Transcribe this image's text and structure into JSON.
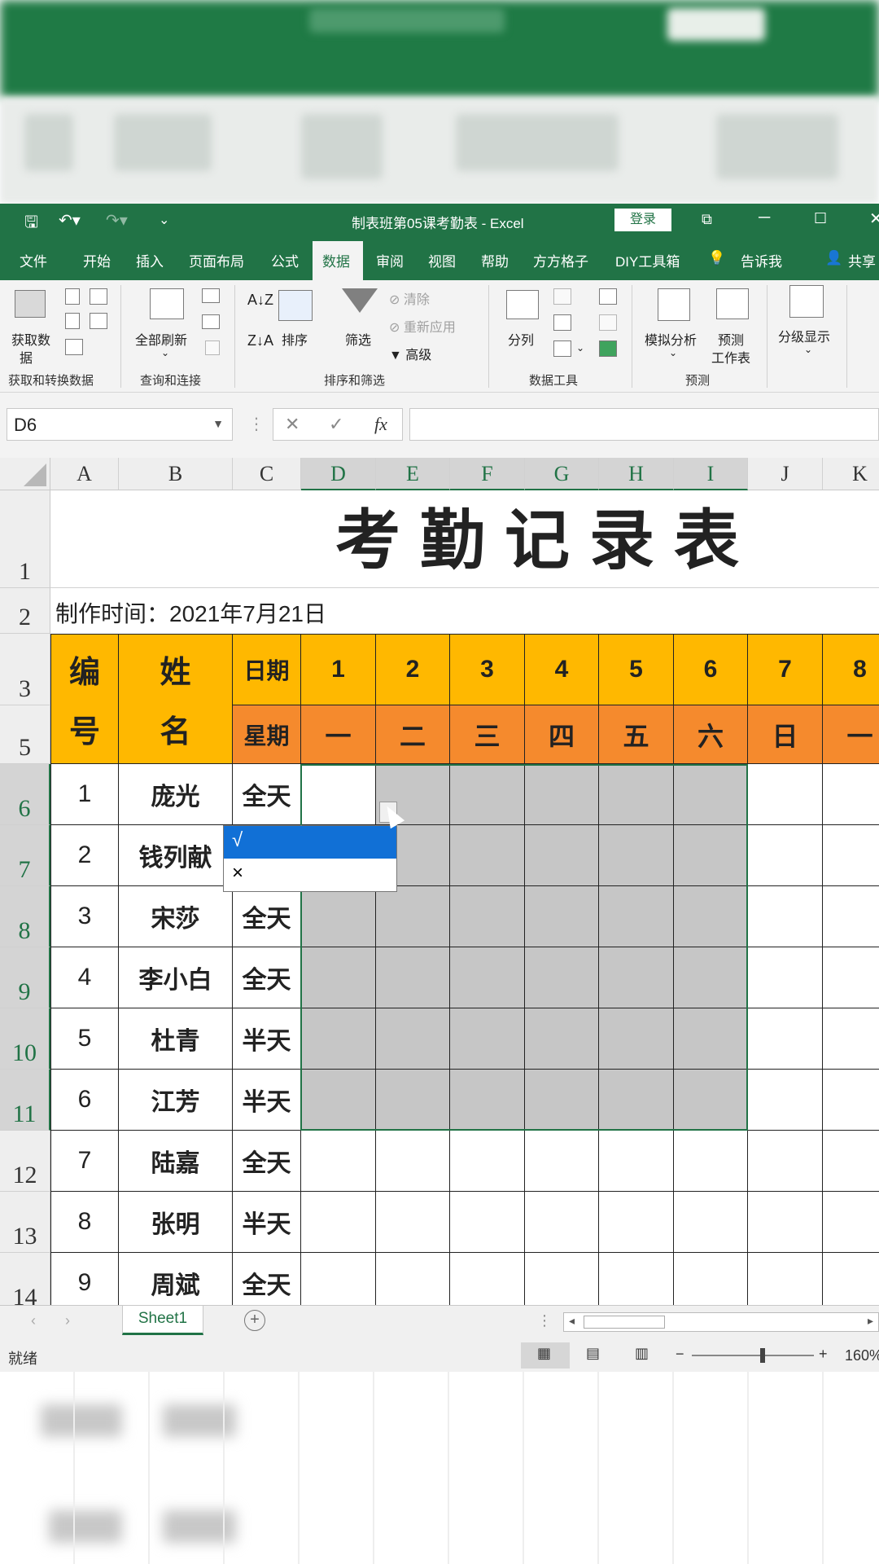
{
  "window": {
    "title": "制表班第05课考勤表  -  Excel",
    "login": "登录",
    "minimize": "─",
    "maximize": "☐",
    "close": "✕",
    "restore": "⧉"
  },
  "menu": [
    "文件",
    "开始",
    "插入",
    "页面布局",
    "公式",
    "数据",
    "审阅",
    "视图",
    "帮助",
    "方方格子",
    "DIY工具箱",
    "告诉我",
    "共享"
  ],
  "ribbon": {
    "get_data": "获取数",
    "get_data2": "据",
    "get_group": "获取和转换数据",
    "refresh": "全部刷新",
    "query_group": "查询和连接",
    "sort": "排序",
    "filter": "筛选",
    "clear": "清除",
    "reapply": "重新应用",
    "advanced": "高级",
    "sort_group": "排序和筛选",
    "split": "分列",
    "tools_group": "数据工具",
    "whatif": "模拟分析",
    "forecast1": "预测",
    "forecast2": "工作表",
    "forecast_group": "预测",
    "outline": "分级显示"
  },
  "formula_bar": {
    "name_box": "D6",
    "cancel": "✕",
    "enter": "✓",
    "fx": "fx",
    "value": ""
  },
  "columns": [
    "A",
    "B",
    "C",
    "D",
    "E",
    "F",
    "G",
    "H",
    "I",
    "J",
    "K"
  ],
  "rows": [
    "1",
    "2",
    "3",
    "5",
    "6",
    "7",
    "8",
    "9",
    "10",
    "11",
    "12",
    "13",
    "14"
  ],
  "sheet": {
    "title": "考勤记录表",
    "created": "制作时间：2021年7月21日",
    "hdr_no": "编",
    "hdr_no2": "号",
    "hdr_name": "姓",
    "hdr_name2": "名",
    "hdr_date": "日期",
    "hdr_week": "星期",
    "days": [
      "1",
      "2",
      "3",
      "4",
      "5",
      "6",
      "7",
      "8"
    ],
    "weekdays": [
      "一",
      "二",
      "三",
      "四",
      "五",
      "六",
      "日",
      "一"
    ],
    "people": [
      {
        "no": "1",
        "name": "庞光",
        "type": "全天"
      },
      {
        "no": "2",
        "name": "钱列献",
        "type": ""
      },
      {
        "no": "3",
        "name": "宋莎",
        "type": "全天"
      },
      {
        "no": "4",
        "name": "李小白",
        "type": "全天"
      },
      {
        "no": "5",
        "name": "杜青",
        "type": "半天"
      },
      {
        "no": "6",
        "name": "江芳",
        "type": "半天"
      },
      {
        "no": "7",
        "name": "陆嘉",
        "type": "全天"
      },
      {
        "no": "8",
        "name": "张明",
        "type": "半天"
      },
      {
        "no": "9",
        "name": "周斌",
        "type": "全天"
      }
    ]
  },
  "dropdown": {
    "options": [
      "√",
      "×"
    ]
  },
  "tabs": {
    "sheet1": "Sheet1",
    "add": "+"
  },
  "status": {
    "ready": "就绪",
    "zoom": "160%",
    "minus": "−",
    "plus": "+"
  },
  "colors": {
    "excel_green": "#217346",
    "header_yellow": "#ffb800",
    "header_orange": "#f58a2d",
    "selection_gray": "#c6c6c6",
    "dropdown_highlight": "#1170d6"
  }
}
